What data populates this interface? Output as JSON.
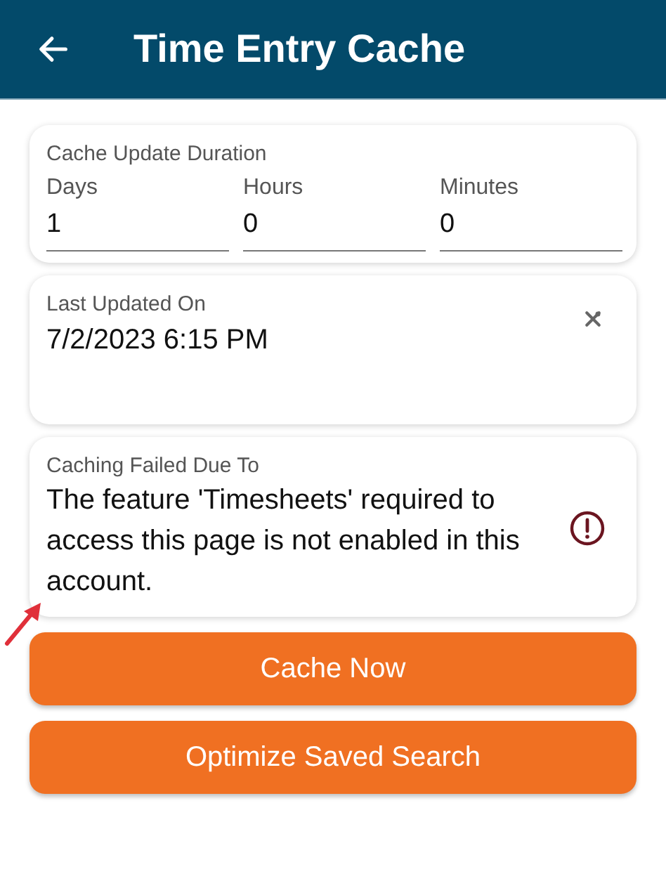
{
  "header": {
    "title": "Time Entry Cache"
  },
  "duration": {
    "title": "Cache Update Duration",
    "fields": [
      {
        "label": "Days",
        "value": "1"
      },
      {
        "label": "Hours",
        "value": "0"
      },
      {
        "label": "Minutes",
        "value": "0"
      }
    ]
  },
  "last_updated": {
    "label": "Last Updated On",
    "value": "7/2/2023 6:15 PM"
  },
  "failure": {
    "label": "Caching Failed Due To",
    "message": "The feature 'Timesheets' required to access this page is not enabled in this account."
  },
  "buttons": [
    {
      "label": "Cache Now"
    },
    {
      "label": "Optimize Saved Search"
    }
  ]
}
